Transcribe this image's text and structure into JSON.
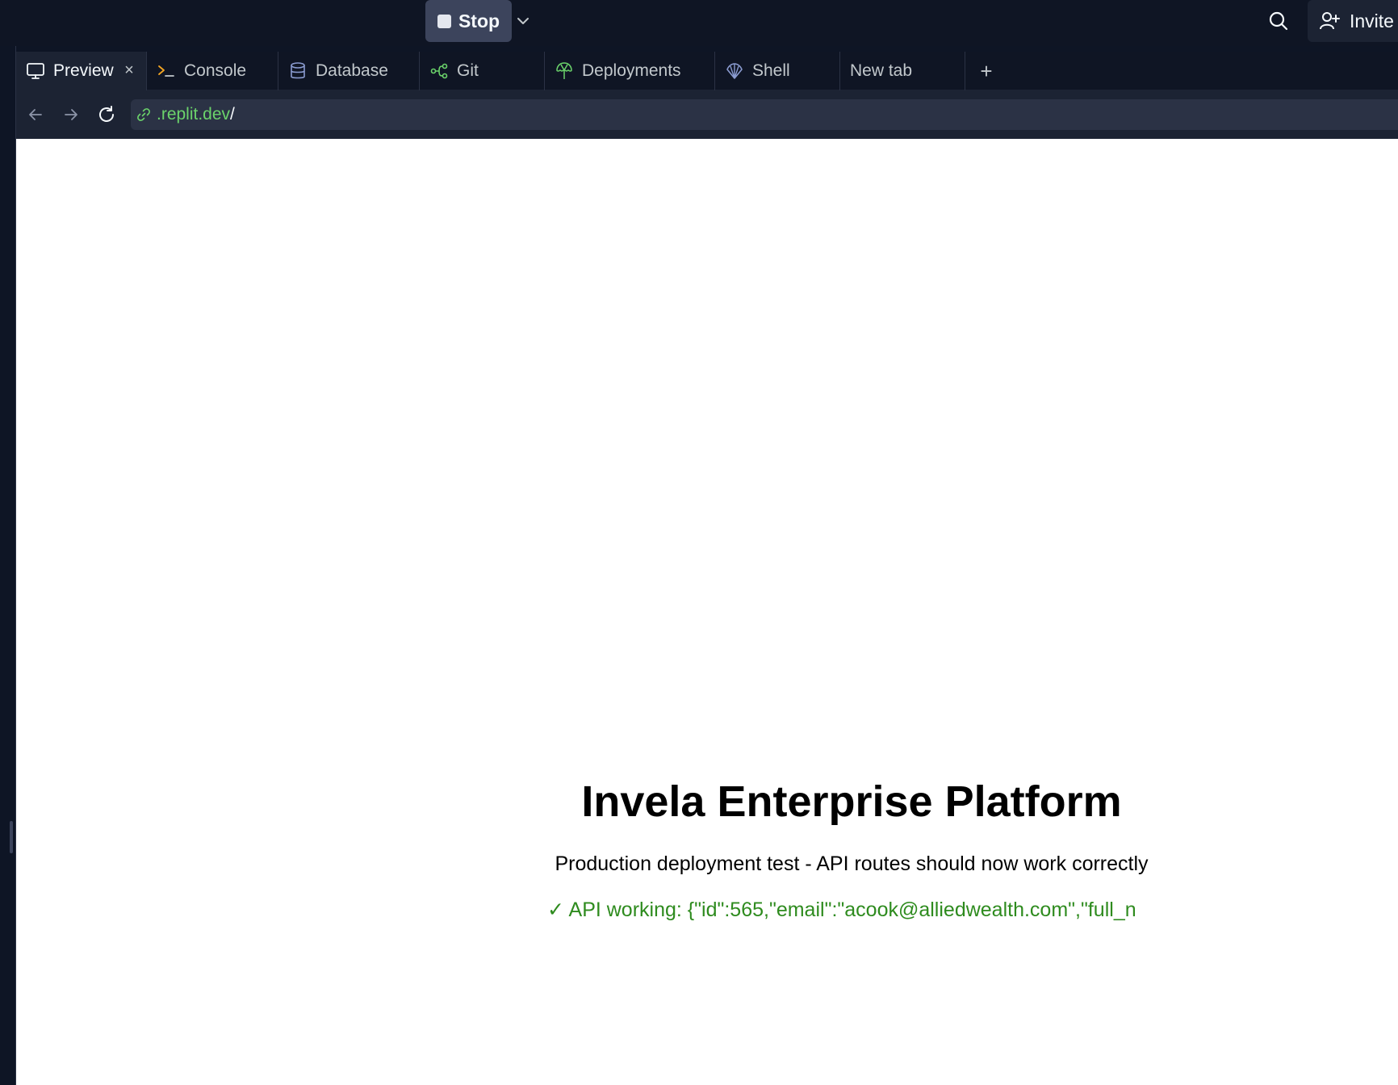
{
  "topbar": {
    "run_button_label": "Stop",
    "invite_label": "Invite"
  },
  "tabs": [
    {
      "label": "Preview",
      "icon": "monitor-icon",
      "active": true,
      "closable": true
    },
    {
      "label": "Console",
      "icon": "terminal-icon",
      "active": false
    },
    {
      "label": "Database",
      "icon": "database-icon",
      "active": false
    },
    {
      "label": "Git",
      "icon": "git-icon",
      "active": false
    },
    {
      "label": "Deployments",
      "icon": "deployments-icon",
      "active": false
    },
    {
      "label": "Shell",
      "icon": "shell-icon",
      "active": false
    },
    {
      "label": "New tab",
      "active": false
    }
  ],
  "url": {
    "host": ".replit.dev",
    "path": "/"
  },
  "page": {
    "heading": "Invela Enterprise Platform",
    "subtitle": "Production deployment test - API routes should now work correctly",
    "api_status": "✓ API working: {\"id\":565,\"email\":\"acook@alliedwealth.com\",\"full_n"
  },
  "colors": {
    "topbar_bg": "#0f1524",
    "url_host": "#6bd36b",
    "api_status": "#2e8b1e"
  }
}
